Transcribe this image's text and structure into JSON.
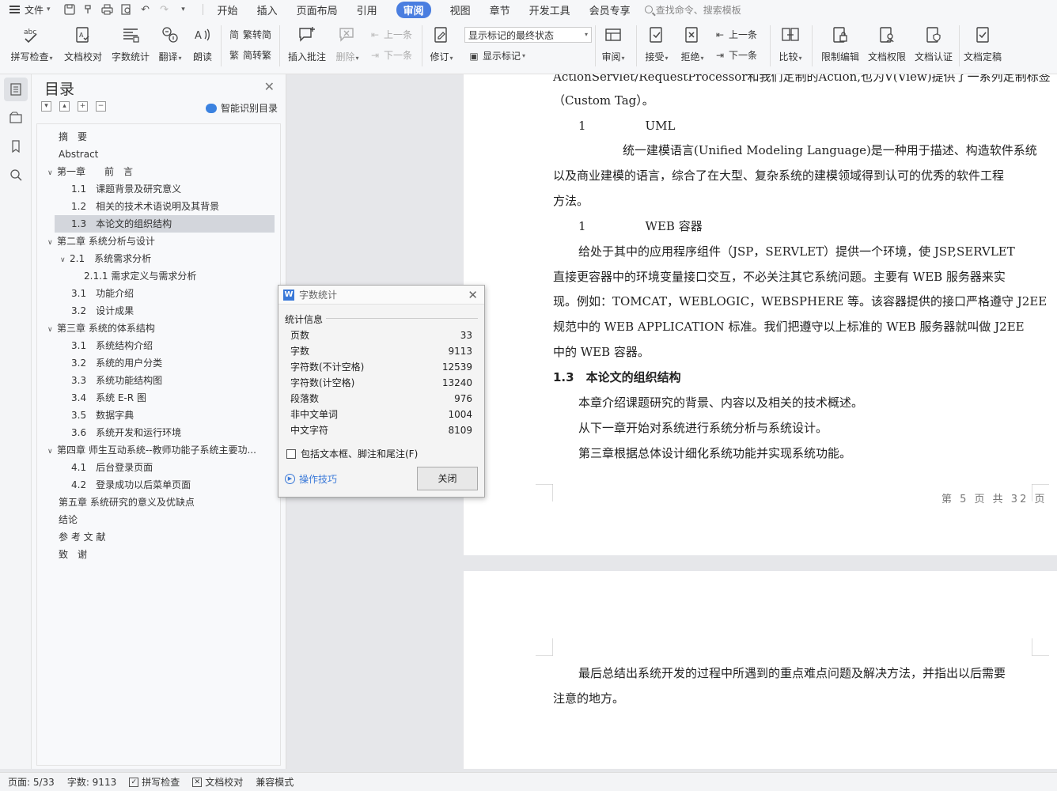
{
  "menubar": {
    "file_label": "文件",
    "tabs": [
      {
        "label": "开始"
      },
      {
        "label": "插入"
      },
      {
        "label": "页面布局"
      },
      {
        "label": "引用"
      },
      {
        "label": "审阅"
      },
      {
        "label": "视图"
      },
      {
        "label": "章节"
      },
      {
        "label": "开发工具"
      },
      {
        "label": "会员专享"
      }
    ],
    "search_placeholder": "查找命令、搜索模板"
  },
  "ribbon": {
    "spell_check": "拼写检查",
    "doc_proof": "文档校对",
    "word_count": "字数统计",
    "translate": "翻译",
    "read_aloud": "朗读",
    "trad_to_simp": "繁转简",
    "simp_to_trad": "简转繁",
    "insert_comment": "插入批注",
    "delete": "删除",
    "prev_comment": "上一条",
    "next_comment": "下一条",
    "track_changes": "修订",
    "markup_state": "显示标记的最终状态",
    "show_markup": "显示标记",
    "review": "审阅",
    "accept": "接受",
    "reject": "拒绝",
    "prev_change": "上一条",
    "next_change": "下一条",
    "compare": "比较",
    "restrict_edit": "限制编辑",
    "doc_permission": "文档权限",
    "doc_certify": "文档认证",
    "doc_finalize": "文档定稿"
  },
  "toc": {
    "title": "目录",
    "smart_label": "智能识别目录",
    "items": [
      {
        "text": "摘　要"
      },
      {
        "text": "Abstract"
      },
      {
        "text": "第一章　　前　言"
      },
      {
        "text": "1.1　课题背景及研究意义"
      },
      {
        "text": "1.2　相关的技术术语说明及其背景"
      },
      {
        "text": "1.3　本论文的组织结构"
      },
      {
        "text": "第二章  系统分析与设计"
      },
      {
        "text": "2.1　系统需求分析"
      },
      {
        "text": "2.1.1 需求定义与需求分析"
      },
      {
        "text": "3.1　功能介绍"
      },
      {
        "text": "3.2　设计成果"
      },
      {
        "text": "第三章  系统的体系结构"
      },
      {
        "text": "3.1　系统结构介绍"
      },
      {
        "text": "3.2　系统的用户分类"
      },
      {
        "text": "3.3　系统功能结构图"
      },
      {
        "text": "3.4　系统 E-R 图"
      },
      {
        "text": "3.5　数据字典"
      },
      {
        "text": "3.6　系统开发和运行环境"
      },
      {
        "text": "第四章  师生互动系统--教师功能子系统主要功..."
      },
      {
        "text": "4.1　后台登录页面"
      },
      {
        "text": "4.2　登录成功以后菜单页面"
      },
      {
        "text": "第五章  系统研究的意义及优缺点"
      },
      {
        "text": "结论"
      },
      {
        "text": "参 考 文 献"
      },
      {
        "text": "致　谢"
      }
    ]
  },
  "doc": {
    "page1_lines": [
      {
        "text": "ActionServlet/RequestProcessor和我们定制的Action,也为V(View)提供了一系列定制标签"
      },
      {
        "text": "（Custom Tag）。"
      },
      {
        "text": "1　　　　　UML"
      },
      {
        "text": "统一建模语言(Unified Modeling Language)是一种用于描述、构造软件系统"
      },
      {
        "text": "以及商业建模的语言，综合了在大型、复杂系统的建模领域得到认可的优秀的软件工程"
      },
      {
        "text": "方法。"
      },
      {
        "text": "1　　　　　WEB 容器"
      },
      {
        "text": "给处于其中的应用程序组件（JSP，SERVLET）提供一个环境，使 JSP,SERVLET"
      },
      {
        "text": "直接更容器中的环境变量接口交互，不必关注其它系统问题。主要有 WEB 服务器来实"
      },
      {
        "text": "现。例如：TOMCAT，WEBLOGIC，WEBSPHERE 等。该容器提供的接口严格遵守 J2EE"
      },
      {
        "text": "规范中的 WEB APPLICATION 标准。我们把遵守以上标准的 WEB 服务器就叫做 J2EE"
      },
      {
        "text": "中的 WEB 容器。"
      },
      {
        "text": "1.3　本论文的组织结构"
      },
      {
        "text": "本章介绍课题研究的背景、内容以及相关的技术概述。"
      },
      {
        "text": "从下一章开始对系统进行系统分析与系统设计。"
      },
      {
        "text": "第三章根据总体设计细化系统功能并实现系统功能。"
      }
    ],
    "page_number": "第 5 页 共 32 页",
    "page2_lines": [
      {
        "text": "最后总结出系统开发的过程中所遇到的重点难点问题及解决方法，并指出以后需要"
      },
      {
        "text": "注意的地方。"
      }
    ]
  },
  "dialog": {
    "title": "字数统计",
    "group_label": "统计信息",
    "stats": [
      {
        "label": "页数",
        "value": "33"
      },
      {
        "label": "字数",
        "value": "9113"
      },
      {
        "label": "字符数(不计空格)",
        "value": "12539"
      },
      {
        "label": "字符数(计空格)",
        "value": "13240"
      },
      {
        "label": "段落数",
        "value": "976"
      },
      {
        "label": "非中文单词",
        "value": "1004"
      },
      {
        "label": "中文字符",
        "value": "8109"
      }
    ],
    "checkbox_label": "包括文本框、脚注和尾注(F)",
    "tips_label": "操作技巧",
    "close_label": "关闭"
  },
  "statusbar": {
    "page": "页面: 5/33",
    "words": "字数: 9113",
    "spell_check": "拼写检查",
    "doc_proof": "文档校对",
    "compat_mode": "兼容模式"
  },
  "colors": {
    "accent": "#4a7ee0",
    "selected_toc": "#d3d6dc"
  }
}
